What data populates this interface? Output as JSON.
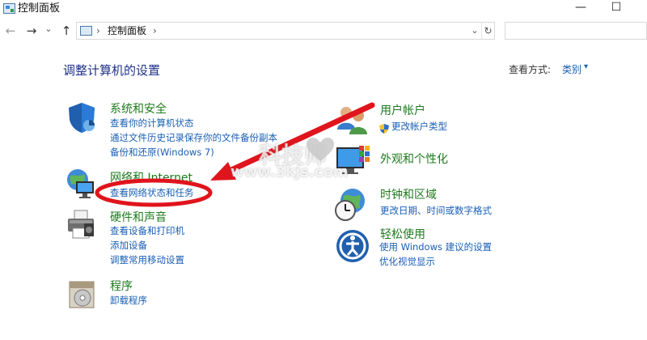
{
  "window": {
    "title": "控制面板",
    "minimize_glyph": "—",
    "maximize_glyph": "☐"
  },
  "nav": {
    "back_glyph": "←",
    "forward_glyph": "→",
    "recent_glyph": "⌄",
    "up_glyph": "↑",
    "breadcrumb": [
      "控制面板"
    ],
    "separator": "›",
    "dropdown_glyph": "⌄",
    "refresh_glyph": "↻"
  },
  "page": {
    "title": "调整计算机的设置",
    "view_by_label": "查看方式:",
    "view_by_value": "类别",
    "view_chevron": "▾"
  },
  "left_categories": [
    {
      "title": "系统和安全",
      "icon": "shield-icon",
      "links": [
        "查看你的计算机状态",
        "通过文件历史记录保存你的文件备份副本",
        "备份和还原(Windows 7)"
      ]
    },
    {
      "title": "网络和 Internet",
      "icon": "globe-network-icon",
      "links": [
        "查看网络状态和任务"
      ]
    },
    {
      "title": "硬件和声音",
      "icon": "printer-icon",
      "links": [
        "查看设备和打印机",
        "添加设备",
        "调整常用移动设置"
      ]
    },
    {
      "title": "程序",
      "icon": "program-disc-icon",
      "links": [
        "卸载程序"
      ]
    }
  ],
  "right_categories": [
    {
      "title": "用户帐户",
      "icon": "users-icon",
      "links": [
        "更改帐户类型"
      ]
    },
    {
      "title": "外观和个性化",
      "icon": "monitor-palette-icon",
      "links": []
    },
    {
      "title": "时钟和区域",
      "icon": "clock-globe-icon",
      "links": [
        "更改日期、时间或数字格式"
      ]
    },
    {
      "title": "轻松使用",
      "icon": "accessibility-icon",
      "links": [
        "使用 Windows 建议的设置",
        "优化视觉显示"
      ]
    }
  ],
  "watermark": {
    "text": "科技师",
    "url": "www.3kjs.com"
  },
  "annotation": {
    "color": "#e0141c"
  }
}
